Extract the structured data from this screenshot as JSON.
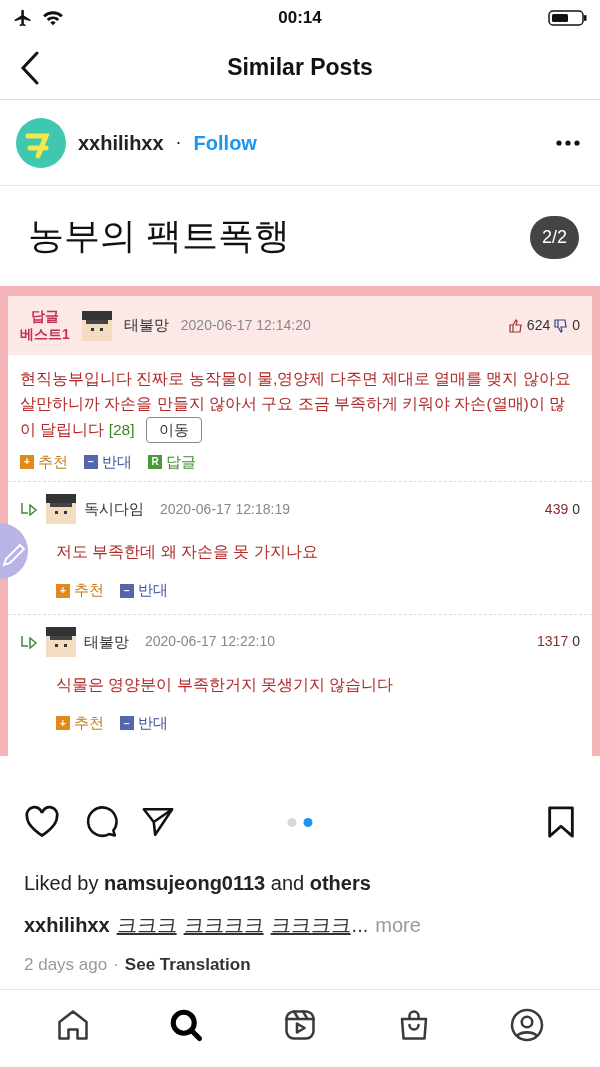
{
  "status_bar": {
    "time": "00:14"
  },
  "header": {
    "title": "Similar Posts"
  },
  "post_header": {
    "username": "xxhilihxx",
    "separator": "·",
    "follow": "Follow"
  },
  "post_image": {
    "title": "농부의 팩트폭행",
    "counter": "2/2",
    "comments": [
      {
        "kind": "best",
        "badge": [
          "답글",
          "베스트1"
        ],
        "author": "태불망",
        "time": "2020-06-17 12:14:20",
        "likes": "624",
        "dislikes": "0",
        "body": "현직농부입니다 진짜로 농작물이 물,영양제 다주면 제대로 열매를 맺지 않아요 살만하니까 자손을 만들지 않아서 구요 조금 부족하게 키워야 자손(열매)이 많이 달립니다",
        "count": "[28]",
        "move": "이동",
        "actions": [
          {
            "kind": "up",
            "glyph": "+",
            "label": "추천"
          },
          {
            "kind": "down",
            "glyph": "−",
            "label": "반대"
          },
          {
            "kind": "reply",
            "glyph": "R",
            "label": "답글"
          }
        ]
      },
      {
        "kind": "reply",
        "author": "독시다임",
        "time": "2020-06-17 12:18:19",
        "likes": "439",
        "dislikes": "0",
        "body": "저도 부족한데 왜 자손을 못 가지나요",
        "actions": [
          {
            "kind": "up",
            "glyph": "+",
            "label": "추천"
          },
          {
            "kind": "down",
            "glyph": "−",
            "label": "반대"
          }
        ]
      },
      {
        "kind": "reply",
        "author": "태불망",
        "time": "2020-06-17 12:22:10",
        "likes": "1317",
        "dislikes": "0",
        "body": "식물은 영양분이 부족한거지 못생기지 않습니다",
        "actions": [
          {
            "kind": "up",
            "glyph": "+",
            "label": "추천"
          },
          {
            "kind": "down",
            "glyph": "−",
            "label": "반대"
          }
        ]
      }
    ]
  },
  "carousel_dots": [
    {
      "selected": false
    },
    {
      "selected": true
    }
  ],
  "likes": "Liked by **namsujeong0113** and **others**",
  "caption": {
    "username": "xxhilihxx",
    "tags": [
      "크크크",
      "크크크크",
      "크크크크"
    ],
    "ellipsis": "...",
    "more": "more"
  },
  "meta": {
    "time": "2 days ago",
    "separator": "·",
    "translate": "See Translation"
  },
  "tab_bar": [
    {
      "kind": "home",
      "selected": false
    },
    {
      "kind": "search",
      "selected": true
    },
    {
      "kind": "reels",
      "selected": false
    },
    {
      "kind": "shop",
      "selected": false
    },
    {
      "kind": "profile",
      "selected": false
    }
  ]
}
